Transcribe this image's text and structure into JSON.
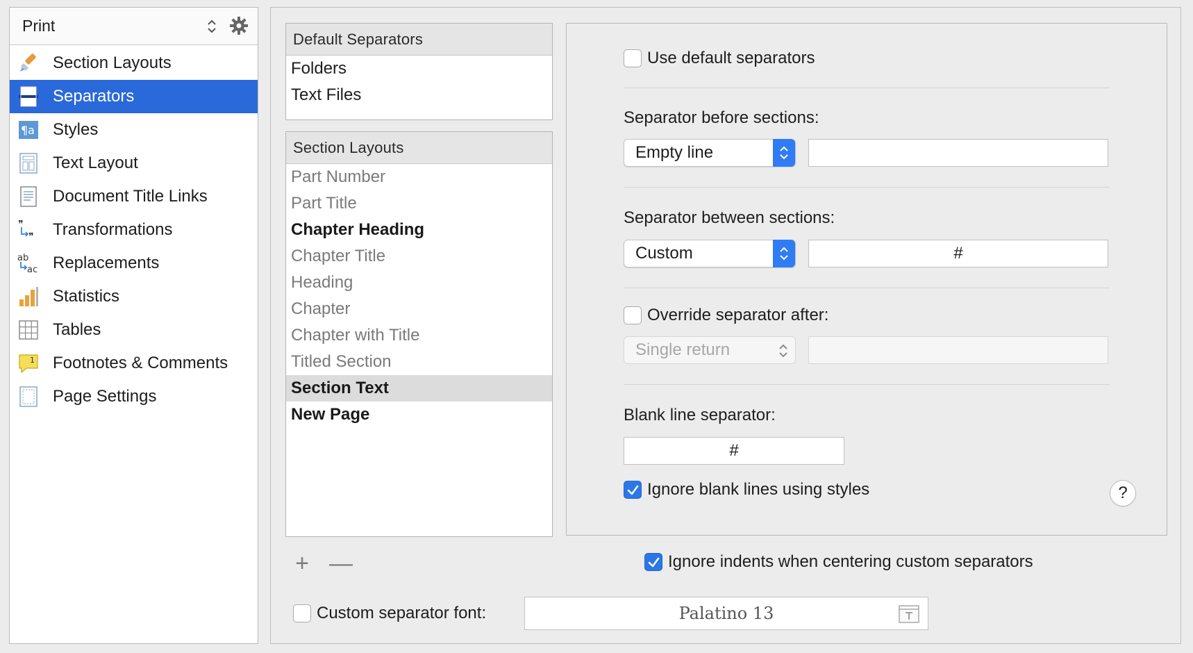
{
  "sidebar": {
    "selector_label": "Print",
    "items": [
      {
        "label": "Section Layouts",
        "icon": "brush-icon"
      },
      {
        "label": "Separators",
        "icon": "separators-icon",
        "selected": true
      },
      {
        "label": "Styles",
        "icon": "styles-icon"
      },
      {
        "label": "Text Layout",
        "icon": "text-layout-icon"
      },
      {
        "label": "Document Title Links",
        "icon": "document-icon"
      },
      {
        "label": "Transformations",
        "icon": "transformations-icon"
      },
      {
        "label": "Replacements",
        "icon": "replacements-icon"
      },
      {
        "label": "Statistics",
        "icon": "statistics-icon"
      },
      {
        "label": "Tables",
        "icon": "tables-icon"
      },
      {
        "label": "Footnotes & Comments",
        "icon": "footnote-icon"
      },
      {
        "label": "Page Settings",
        "icon": "page-settings-icon"
      }
    ]
  },
  "default_separators": {
    "header": "Default Separators",
    "items": [
      "Folders",
      "Text Files"
    ]
  },
  "section_layouts": {
    "header": "Section Layouts",
    "items": [
      {
        "label": "Part Number",
        "style": "dim"
      },
      {
        "label": "Part Title",
        "style": "dim"
      },
      {
        "label": "Chapter Heading",
        "style": "bold"
      },
      {
        "label": "Chapter Title",
        "style": "dim"
      },
      {
        "label": "Heading",
        "style": "dim"
      },
      {
        "label": "Chapter",
        "style": "dim"
      },
      {
        "label": "Chapter with Title",
        "style": "dim"
      },
      {
        "label": "Titled Section",
        "style": "dim"
      },
      {
        "label": "Section Text",
        "style": "bold",
        "selected": true
      },
      {
        "label": "New Page",
        "style": "bold"
      }
    ],
    "add_label": "+",
    "remove_label": "—"
  },
  "settings": {
    "use_default_label": "Use default separators",
    "use_default_checked": false,
    "before_title": "Separator before sections:",
    "before_popup": "Empty line",
    "before_field": "",
    "between_title": "Separator between sections:",
    "between_popup": "Custom",
    "between_field": "#",
    "override_label": "Override separator after:",
    "override_checked": false,
    "override_popup": "Single return",
    "override_field": "",
    "blank_title": "Blank line separator:",
    "blank_field": "#",
    "ignore_blank_label": "Ignore blank lines using styles",
    "ignore_blank_checked": true,
    "help_label": "?"
  },
  "footer": {
    "ignore_indents_label": "Ignore indents when centering custom separators",
    "ignore_indents_checked": true,
    "custom_font_label": "Custom separator font:",
    "custom_font_checked": false,
    "font_value": "Palatino 13"
  },
  "colors": {
    "accent": "#2a69d9",
    "checkbox_on": "#2b77e6"
  }
}
